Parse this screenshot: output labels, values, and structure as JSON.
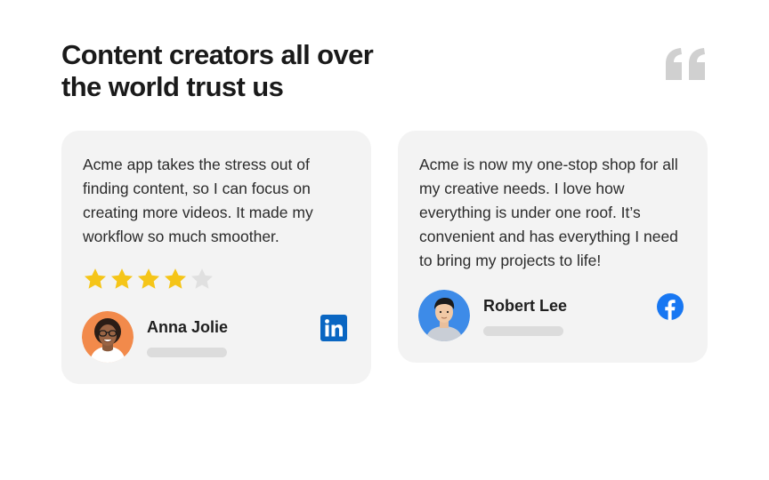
{
  "header": {
    "headline_line1": "Content creators all over",
    "headline_line2": "the world trust us",
    "quote_icon": "quote-icon"
  },
  "testimonials": [
    {
      "text": "Acme app takes the stress out of finding content, so I can focus on creating more videos. It made my workflow so much smoother.",
      "rating": 4,
      "rating_max": 5,
      "author": "Anna Jolie",
      "social_icon": "linkedin-icon"
    },
    {
      "text": "Acme is now my one-stop shop for all my creative needs. I love how everything is under one roof. It’s convenient and has everything I need to bring my projects to life!",
      "author": "Robert Lee",
      "social_icon": "facebook-icon"
    }
  ],
  "colors": {
    "card_background": "#f3f3f3",
    "star_filled": "#f5c518",
    "star_empty": "#e0e0e0",
    "linkedin": "#0a66c2",
    "facebook": "#1877f2",
    "quote_mark": "#d0d0d0"
  }
}
